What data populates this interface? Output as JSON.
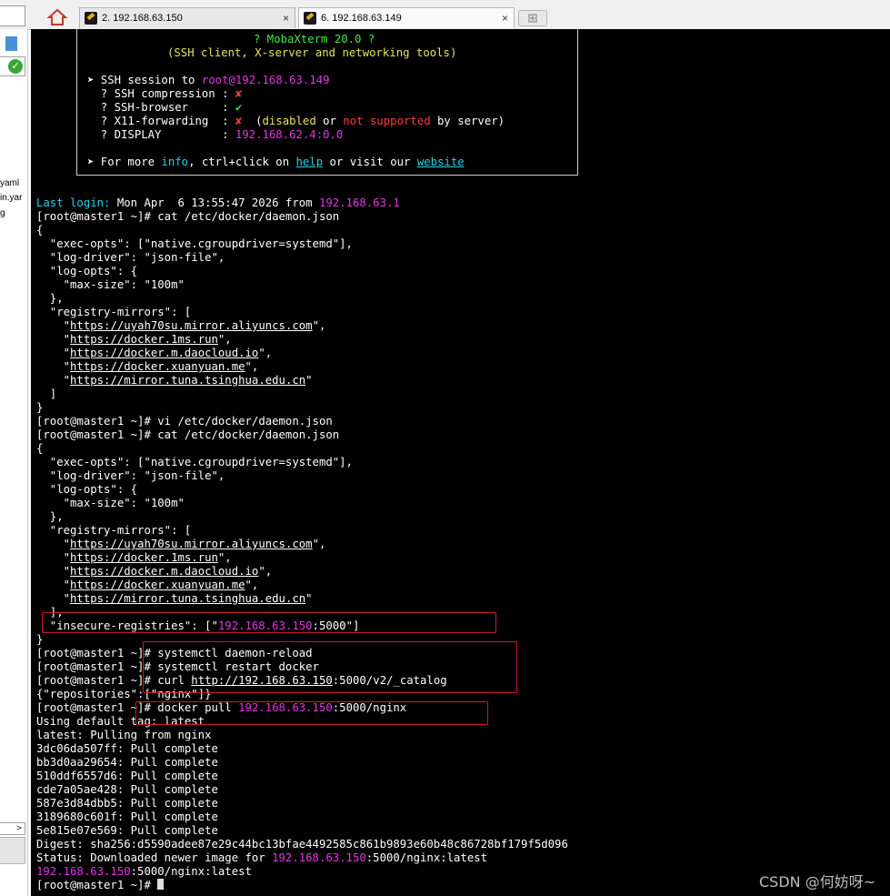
{
  "tabs": [
    {
      "label": "2. 192.168.63.150",
      "close": "×"
    },
    {
      "label": "6. 192.168.63.149",
      "close": "×"
    }
  ],
  "sidebar": {
    "files": [
      "yaml",
      "in.yar",
      "g"
    ],
    "check": "✓",
    "scroll_arrow": ">"
  },
  "banner": {
    "title": "? MobaXterm 20.0 ?",
    "subtitle": "(SSH client, X-server and networking tools)",
    "session_prefix": "➤ SSH session to ",
    "user": "root",
    "host": "@192.168.63.149",
    "rows": [
      {
        "label": "  ? SSH compression : ",
        "value": "✘"
      },
      {
        "label": "  ? SSH-browser     : ",
        "value": "✔"
      },
      {
        "label": "  ? X11-forwarding  : ",
        "value": "✘",
        "paren_open": "  (",
        "disabled": "disabled",
        "or": " or ",
        "not_supported": "not supported",
        "tail": " by server)"
      },
      {
        "label": "  ? DISPLAY         : ",
        "value": "192.168.62.4:0.0"
      }
    ],
    "more_a": "➤ For more ",
    "info": "info",
    "more_b": ", ctrl+click on ",
    "help": "help",
    "more_c": " or visit our ",
    "website": "website"
  },
  "terminal": {
    "last_login_label": "Last login:",
    "last_login_text": " Mon Apr  6 13:55:47 2026 from ",
    "last_login_ip": "192.168.63.1",
    "prompt": "[root@master1 ~]# ",
    "cmd_cat": "cat /etc/docker/daemon.json",
    "cmd_vi": "vi /etc/docker/daemon.json",
    "json": {
      "open": "{",
      "exec_opts": "  \"exec-opts\": [\"native.cgroupdriver=systemd\"],",
      "log_driver": "  \"log-driver\": \"json-file\",",
      "log_opts": "  \"log-opts\": {",
      "max_size": "    \"max-size\": \"100m\"",
      "close_obj": "  },",
      "mirrors": "  \"registry-mirrors\": [",
      "q": "    \"",
      "qc": "\",",
      "qe": "\"",
      "urls": [
        "https://uyah70su.mirror.aliyuncs.com",
        "https://docker.1ms.run",
        "https://docker.m.daocloud.io",
        "https://docker.xuanyuan.me",
        "https://mirror.tuna.tsinghua.edu.cn"
      ],
      "close_arr": "  ]",
      "close_arr2": "  ],",
      "insecure_a": "  \"insecure-registries\": [\"",
      "insecure_ip": "192.168.63.150",
      "insecure_b": ":5000\"]",
      "close": "}"
    },
    "cmd_reload": "systemctl daemon-reload",
    "cmd_restart": "systemctl restart docker",
    "cmd_curl_a": "curl ",
    "cmd_curl_url_a": "http://",
    "cmd_curl_url_b": "192.168.63.150",
    "cmd_curl_b": ":5000/v2/_catalog",
    "curl_out": "{\"repositories\":[\"nginx\"]}",
    "cmd_pull_a": "docker pull ",
    "cmd_pull_ip": "192.168.63.150",
    "cmd_pull_b": ":5000/nginx",
    "pull_lines": [
      "Using default tag: latest",
      "latest: Pulling from nginx",
      "3dc06da507ff: Pull complete",
      "bb3d0aa29654: Pull complete",
      "510ddf6557d6: Pull complete",
      "cde7a05ae428: Pull complete",
      "587e3d84dbb5: Pull complete",
      "3189680c601f: Pull complete",
      "5e815e07e569: Pull complete",
      "Digest: sha256:d5590adee87e29c44bc13bfae4492585c861b9893e60b48c86728bf179f5d096"
    ],
    "status_a": "Status: Downloaded newer image for ",
    "status_ip": "192.168.63.150",
    "status_b": ":5000/nginx:latest",
    "final_ip": "192.168.63.150",
    "final_b": ":5000/nginx:latest"
  },
  "watermark": "CSDN @何妨呀~",
  "colors": {
    "terminal_bg": "#000000",
    "magenta": "#e135e1",
    "cyan": "#22d3e8",
    "yellow": "#e8e35a",
    "highlight_box": "#d11a2a"
  }
}
